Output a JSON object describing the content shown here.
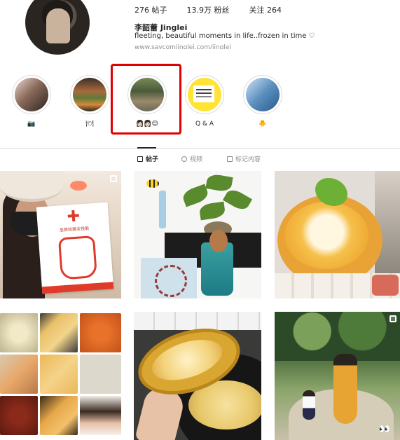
{
  "profile": {
    "stats": {
      "posts": "276 帖子",
      "followers": "13.9万 粉丝",
      "following": "关注 264"
    },
    "name": "李韶蕾 Jinglei",
    "bio": "fleeting, beautiful moments in life..frozen in time ♡",
    "link": "www.saycomjinglei.com/jinglei"
  },
  "highlights": [
    {
      "label": "📷",
      "selected": false
    },
    {
      "label": "🍽",
      "selected": false
    },
    {
      "label": "👩🏻👩🏻😊",
      "selected": true
    },
    {
      "label": "Q & A",
      "selected": false
    },
    {
      "label": "🐥",
      "selected": false
    }
  ],
  "tabs": [
    {
      "label": "帖子",
      "active": true,
      "icon": "grid-icon"
    },
    {
      "label": "视频",
      "active": false,
      "icon": "reels-icon"
    },
    {
      "label": "标记内容",
      "active": false,
      "icon": "tagged-icon"
    }
  ],
  "posts": {
    "post1": {
      "type": "reel",
      "book_title": "急救知識全技能"
    },
    "post2": {
      "type": "photo"
    },
    "post3": {
      "type": "photo"
    },
    "post4": {
      "type": "photo"
    },
    "post5": {
      "type": "photo"
    },
    "post6": {
      "type": "carousel",
      "sticker": "👀"
    }
  },
  "colors": {
    "highlight_box": "#e00000",
    "text": "#262626",
    "muted": "#8e8e8e"
  }
}
